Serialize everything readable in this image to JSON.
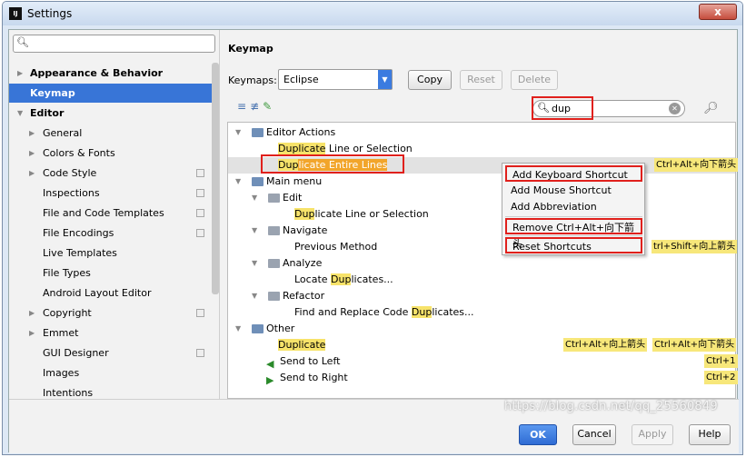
{
  "window": {
    "title": "Settings",
    "logo": "IJ",
    "close_label": "x"
  },
  "sidebar": {
    "search_placeholder": "",
    "items": [
      {
        "label": "Appearance & Behavior",
        "expanded": false
      },
      {
        "label": "Keymap",
        "selected": true
      },
      {
        "label": "Editor",
        "expanded": true
      },
      {
        "label": "General"
      },
      {
        "label": "Colors & Fonts"
      },
      {
        "label": "Code Style"
      },
      {
        "label": "Inspections"
      },
      {
        "label": "File and Code Templates"
      },
      {
        "label": "File Encodings"
      },
      {
        "label": "Live Templates"
      },
      {
        "label": "File Types"
      },
      {
        "label": "Android Layout Editor"
      },
      {
        "label": "Copyright"
      },
      {
        "label": "Emmet"
      },
      {
        "label": "GUI Designer"
      },
      {
        "label": "Images"
      },
      {
        "label": "Intentions"
      }
    ]
  },
  "keymap": {
    "title": "Keymap",
    "keymaps_label": "Keymaps:",
    "selected_keymap": "Eclipse",
    "copy_label": "Copy",
    "reset_label": "Reset",
    "delete_label": "Delete",
    "filter_value": "dup"
  },
  "tree": {
    "editor_actions": "Editor Actions",
    "dup_line_hl": "Duplicate",
    "dup_line_rest": " Line or Selection",
    "dup_entire_hl": "Dup",
    "dup_entire_rest": "licate Entire Lines",
    "dup_entire_shortcut": "Ctrl+Alt+向下箭头",
    "main_menu": "Main menu",
    "edit": "Edit",
    "edit_dup_hl": "Dup",
    "edit_dup_rest": "licate Line or Selection",
    "navigate": "Navigate",
    "prev_method": "Previous Method",
    "prev_method_shortcut": "trl+Shift+向上箭头",
    "analyze": "Analyze",
    "locate_pre": "Locate ",
    "locate_hl": "Dup",
    "locate_rest": "licates...",
    "refactor": "Refactor",
    "find_pre": "Find and Replace Code ",
    "find_hl": "Dup",
    "find_rest": "licates...",
    "other": "Other",
    "other_dup_hl": "Duplicate",
    "other_dup_short1": "Ctrl+Alt+向上箭头",
    "other_dup_short2": "Ctrl+Alt+向下箭头",
    "send_left": "Send to Left",
    "send_left_shortcut": "Ctrl+1",
    "send_right": "Send to Right",
    "send_right_shortcut": "Ctrl+2"
  },
  "context_menu": {
    "items": [
      "Add Keyboard Shortcut",
      "Add Mouse Shortcut",
      "Add Abbreviation",
      "Remove Ctrl+Alt+向下箭头",
      "Reset Shortcuts"
    ]
  },
  "footer": {
    "ok": "OK",
    "cancel": "Cancel",
    "apply": "Apply",
    "help": "Help"
  },
  "watermark": "https://blog.csdn.net/qq_25560849",
  "colors": {
    "selection": "#3875d7",
    "highlight": "#f7e36a",
    "annotation_box": "#e0201c"
  }
}
